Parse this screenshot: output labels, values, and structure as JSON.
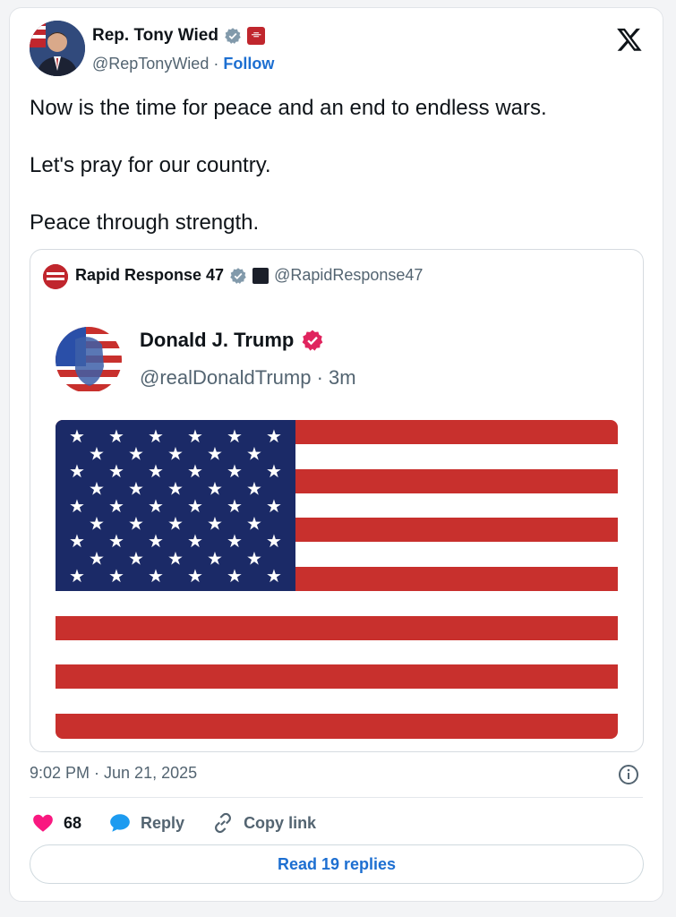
{
  "author": {
    "name": "Rep. Tony Wied",
    "handle": "@RepTonyWied",
    "separator": "·",
    "follow_label": "Follow"
  },
  "tweet": {
    "text": "Now is the time for peace and an end to endless wars.\n\nLet's pray for our country.\n\nPeace through strength."
  },
  "quote": {
    "name": "Rapid Response 47",
    "handle": "@RapidResponse47",
    "inner_post": {
      "name": "Donald J. Trump",
      "handle_time": "@realDonaldTrump · 3m"
    }
  },
  "meta": {
    "timestamp": "9:02 PM · Jun 21, 2025"
  },
  "actions": {
    "likes": "68",
    "reply_label": "Reply",
    "copy_label": "Copy link"
  },
  "read_replies_label": "Read 19 replies",
  "colors": {
    "verified_blue": "#1d9bf0",
    "verified_red": "#e0245e",
    "link_blue": "#1d6fd1",
    "like_pink": "#f91880",
    "flag_red": "#c8302d",
    "flag_blue": "#1b2a67"
  },
  "icons": [
    "verified-icon",
    "x-logo-icon",
    "info-icon",
    "heart-icon",
    "reply-bubble-icon",
    "link-icon"
  ]
}
